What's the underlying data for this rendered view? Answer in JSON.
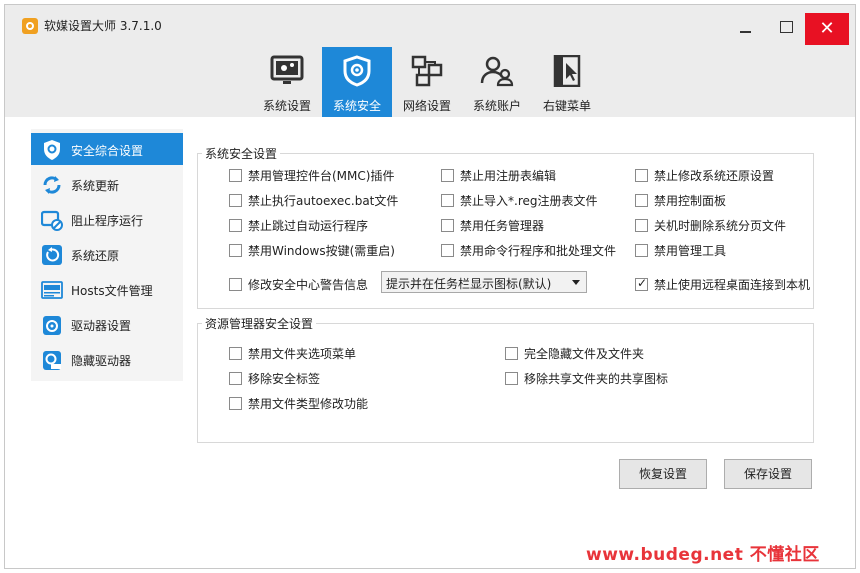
{
  "window": {
    "title": "软媒设置大师 3.7.1.0",
    "close_glyph": "✕"
  },
  "nav": {
    "tabs": [
      {
        "label": "系统设置",
        "icon": "monitor-gear-icon"
      },
      {
        "label": "系统安全",
        "icon": "shield-icon"
      },
      {
        "label": "网络设置",
        "icon": "network-icon"
      },
      {
        "label": "系统账户",
        "icon": "users-icon"
      },
      {
        "label": "右键菜单",
        "icon": "context-menu-icon"
      }
    ],
    "active_index": 1
  },
  "sidebar": {
    "items": [
      {
        "label": "安全综合设置",
        "icon": "shield-icon"
      },
      {
        "label": "系统更新",
        "icon": "refresh-icon"
      },
      {
        "label": "阻止程序运行",
        "icon": "block-app-icon"
      },
      {
        "label": "系统还原",
        "icon": "restore-icon"
      },
      {
        "label": "Hosts文件管理",
        "icon": "hosts-icon"
      },
      {
        "label": "驱动器设置",
        "icon": "drive-icon"
      },
      {
        "label": "隐藏驱动器",
        "icon": "hide-drive-icon"
      }
    ],
    "active_index": 0
  },
  "security_group": {
    "title": "系统安全设置",
    "options": [
      {
        "label": "禁用管理控件台(MMC)插件",
        "checked": false
      },
      {
        "label": "禁止用注册表编辑",
        "checked": false
      },
      {
        "label": "禁止修改系统还原设置",
        "checked": false
      },
      {
        "label": "禁止执行autoexec.bat文件",
        "checked": false
      },
      {
        "label": "禁止导入*.reg注册表文件",
        "checked": false
      },
      {
        "label": "禁用控制面板",
        "checked": false
      },
      {
        "label": "禁止跳过自动运行程序",
        "checked": false
      },
      {
        "label": "禁用任务管理器",
        "checked": false
      },
      {
        "label": "关机时删除系统分页文件",
        "checked": false
      },
      {
        "label": "禁用Windows按键(需重启)",
        "checked": false
      },
      {
        "label": "禁用命令行程序和批处理文件",
        "checked": false
      },
      {
        "label": "禁用管理工具",
        "checked": false
      }
    ],
    "security_center": {
      "label": "修改安全中心警告信息",
      "checked": false
    },
    "dropdown_value": "提示并在任务栏显示图标(默认)",
    "remote_desktop": {
      "label": "禁止使用远程桌面连接到本机",
      "checked": true
    }
  },
  "explorer_group": {
    "title": "资源管理器安全设置",
    "options": [
      {
        "label": "禁用文件夹选项菜单",
        "checked": false
      },
      {
        "label": "完全隐藏文件及文件夹",
        "checked": false
      },
      {
        "label": "移除安全标签",
        "checked": false
      },
      {
        "label": "移除共享文件夹的共享图标",
        "checked": false
      },
      {
        "label": "禁用文件类型修改功能",
        "checked": false
      }
    ]
  },
  "buttons": {
    "restore": "恢复设置",
    "save": "保存设置"
  },
  "watermark": "www.budeg.net 不懂社区",
  "colors": {
    "accent": "#1e88d8",
    "close": "#e81123",
    "watermark": "#e8343a"
  }
}
